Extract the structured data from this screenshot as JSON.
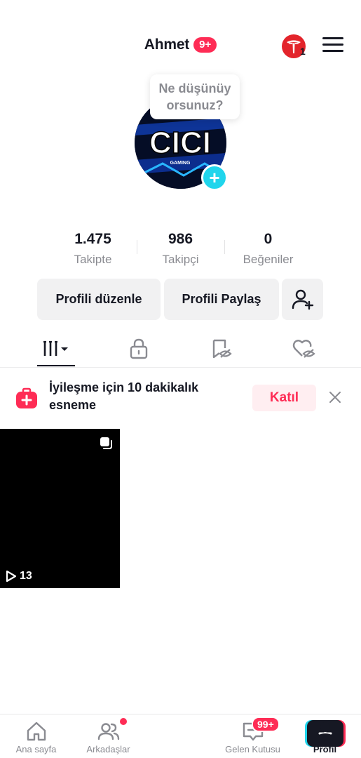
{
  "header": {
    "username": "Ahmet",
    "notification_badge": "9+",
    "tesla_count": "1",
    "menu_icon": "hamburger-menu-icon"
  },
  "avatar": {
    "logo_text": "CICI",
    "logo_subtext": "GAMING",
    "bubble_text_line1": "Ne düşünüy",
    "bubble_text_line2": "orsunuz?"
  },
  "stats": [
    {
      "value": "1.475",
      "label": "Takipte"
    },
    {
      "value": "986",
      "label": "Takipçi"
    },
    {
      "value": "0",
      "label": "Beğeniler"
    }
  ],
  "buttons": {
    "edit_profile": "Profili düzenle",
    "share_profile": "Profili Paylaş",
    "add_friend_icon": "add-user-icon"
  },
  "tabs": [
    {
      "icon": "grid-videos-icon",
      "active": true
    },
    {
      "icon": "lock-icon",
      "active": false
    },
    {
      "icon": "hidden-bookmark-icon",
      "active": false
    },
    {
      "icon": "hidden-liked-icon",
      "active": false
    }
  ],
  "banner": {
    "text": "İyileşme için 10 dakikalık esneme",
    "join_label": "Katıl"
  },
  "video": {
    "play_count": "13"
  },
  "bottom_nav": {
    "home": "Ana sayfa",
    "friends": "Arkadaşlar",
    "inbox": "Gelen Kutusu",
    "inbox_badge": "99+",
    "profile": "Profil"
  },
  "colors": {
    "accent_red": "#fe2c55",
    "accent_cyan": "#20d5ec",
    "text_primary": "#161823",
    "text_secondary": "#8a8b91",
    "button_bg": "#f1f1f2"
  }
}
